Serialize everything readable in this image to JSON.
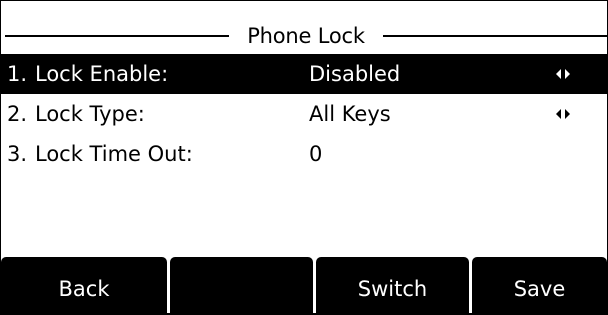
{
  "title": "Phone Lock",
  "colors": {
    "background": "#ffffff",
    "selected_row": "#000000",
    "softkey_bg": "#000000"
  },
  "menu": {
    "items": [
      {
        "index": "1.",
        "label": "Lock Enable:",
        "value": "Disabled",
        "has_selector": true,
        "selected": true,
        "icon": "left-right-arrows-icon"
      },
      {
        "index": "2.",
        "label": "Lock Type:",
        "value": "All Keys",
        "has_selector": true,
        "selected": false,
        "icon": "left-right-arrows-icon"
      },
      {
        "index": "3.",
        "label": "Lock Time Out:",
        "value": "0",
        "has_selector": false,
        "selected": false
      }
    ]
  },
  "softkeys": [
    "Back",
    "",
    "Switch",
    "Save"
  ]
}
